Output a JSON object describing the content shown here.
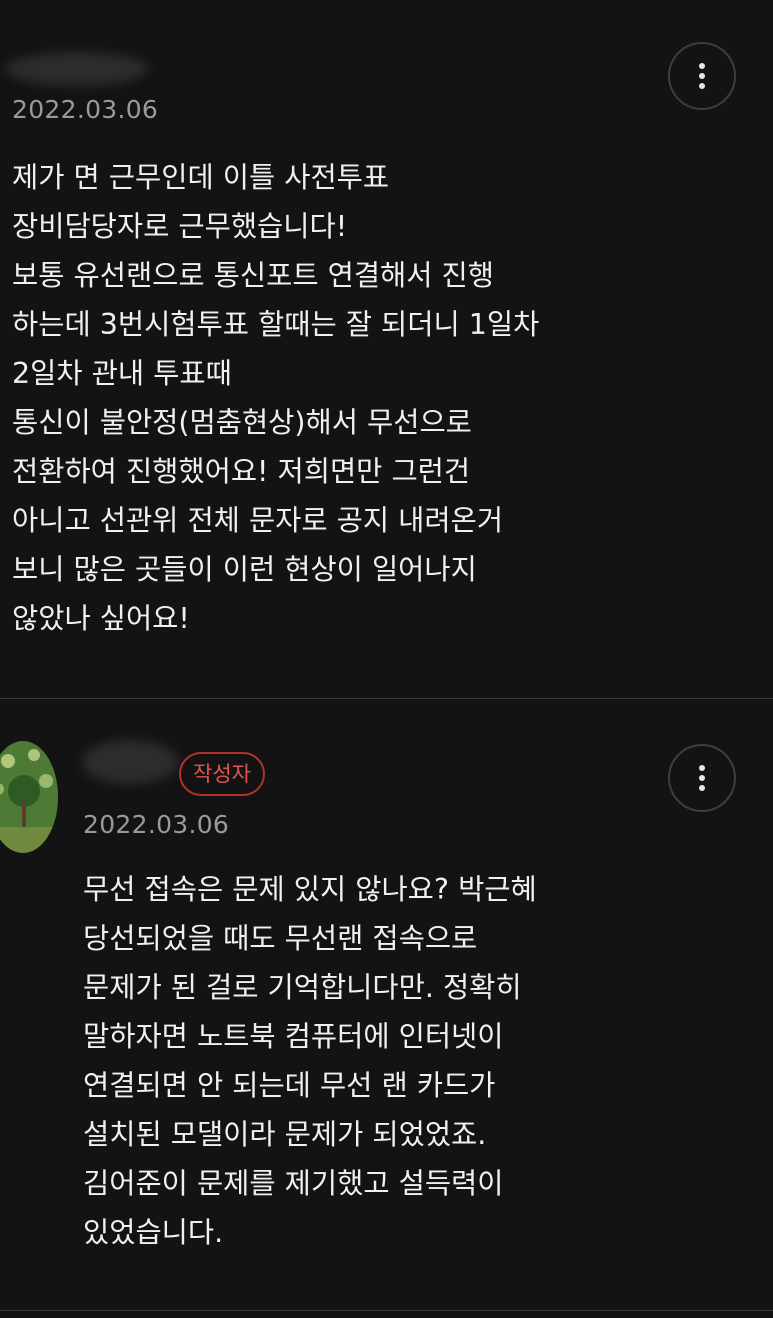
{
  "comments": [
    {
      "date": "2022.03.06",
      "lines": [
        "제가 면 근무인데 이틀 사전투표",
        "장비담당자로 근무했습니다!",
        "보통 유선랜으로 통신포트 연결해서 진행",
        "하는데 3번시험투표 할때는 잘 되더니 1일차",
        "2일차 관내 투표때",
        "통신이 불안정(멈춤현상)해서 무선으로",
        "전환하여 진행했어요! 저희면만 그런건",
        "아니고 선관위 전체 문자로 공지 내려온거",
        "보니 많은 곳들이 이런 현상이 일어나지",
        "않았나 싶어요!"
      ]
    },
    {
      "author_badge": "작성자",
      "date": "2022.03.06",
      "lines": [
        "무선 접속은 문제 있지 않나요? 박근혜",
        "당선되었을 때도 무선랜 접속으로",
        "문제가 된 걸로 기억합니다만. 정확히",
        "말하자면 노트북 컴퓨터에 인터넷이",
        "연결되면 안 되는데 무선 랜 카드가",
        "설치된 모댈이라 문제가 되었었죠.",
        "김어준이 문제를 제기했고 설득력이",
        "있었습니다."
      ]
    }
  ],
  "icons": {
    "more": "more-vertical-icon"
  },
  "colors": {
    "background": "#131314",
    "text": "#f0f0f0",
    "date": "#9a9a9e",
    "badge": "#e0554d",
    "badge_border": "#b1322b",
    "divider": "#3a3a3c"
  }
}
